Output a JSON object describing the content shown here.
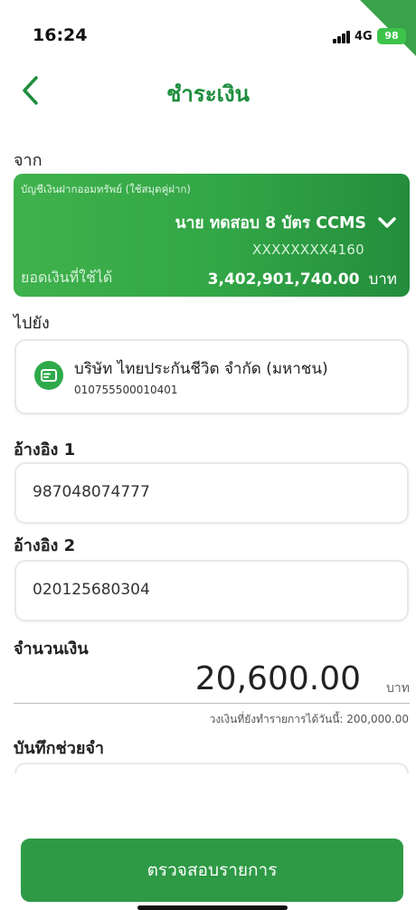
{
  "status_bar": {
    "time": "16:24",
    "network": "4G",
    "battery": "98"
  },
  "header": {
    "title": "ชำระเงิน",
    "back_icon": "chevron-left-icon"
  },
  "from_section": {
    "label": "จาก",
    "account_type": "บัญชีเงินฝากออมทรัพย์ (ใช้สมุดคู่ฝาก)",
    "account_name": "นาย ทดสอบ 8 บัตร CCMS",
    "account_number": "XXXXXXXX4160",
    "available_label": "ยอดเงินที่ใช้ได้",
    "available_amount": "3,402,901,740.00",
    "available_unit": "บาท"
  },
  "to_section": {
    "label": "ไปยัง",
    "payee_name": "บริษัท ไทยประกันชีวิต จำกัด (มหาชน)",
    "payee_account": "010755500010401",
    "payee_icon": "bill-icon"
  },
  "ref1": {
    "label": "อ้างอิง 1",
    "value": "987048074777"
  },
  "ref2": {
    "label": "อ้างอิง 2",
    "value": "020125680304"
  },
  "amount": {
    "label": "จำนวนเงิน",
    "value": "20,600.00",
    "unit": "บาท",
    "limit_text": "วงเงินที่ยังทำรายการได้วันนี้: 200,000.00"
  },
  "memo": {
    "label": "บันทึกช่วยจำ"
  },
  "footer": {
    "confirm_label": "ตรวจสอบรายการ"
  },
  "colors": {
    "brand_green": "#2e9a45",
    "title_green": "#1e8e3e"
  }
}
